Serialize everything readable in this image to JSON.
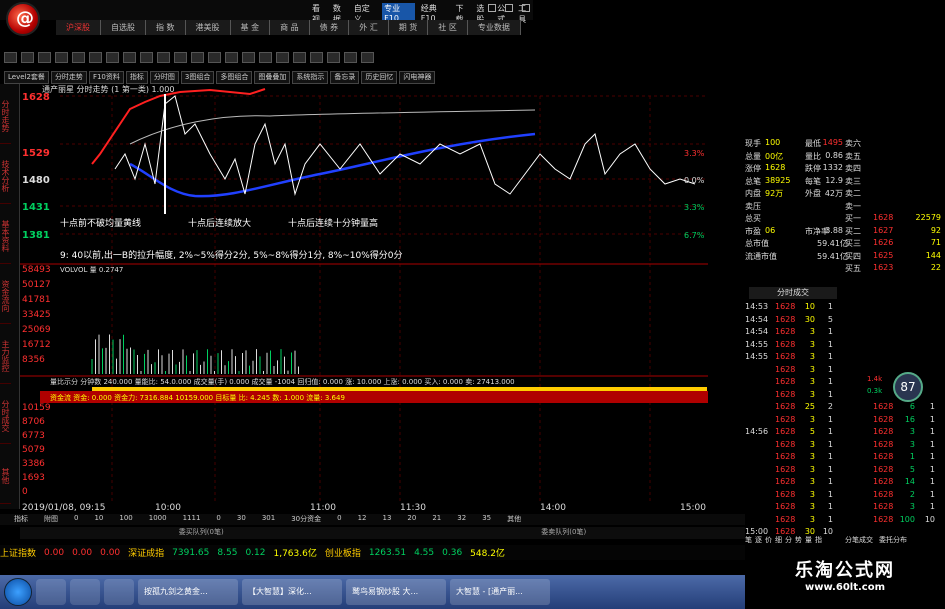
{
  "app": {
    "top_menu": [
      "看视",
      "数据",
      "自定义",
      "专业F10",
      "经典F10",
      "下载",
      "选股",
      "公式",
      "工具"
    ],
    "top_menu_active": "专业F10"
  },
  "nav_tabs": [
    "沪深股",
    "自选股",
    "指 数",
    "港美股",
    "基 金",
    "商 品",
    "债 券",
    "外 汇",
    "期 货",
    "社 区",
    "专业数据"
  ],
  "toolbar2": [
    "Level2套餐",
    "分时走势",
    "F10资料",
    "指标",
    "分时图",
    "3图组合",
    "多图组合",
    "图叠叠加",
    "系统指示",
    "备忘录",
    "历史回忆",
    "闪电神器"
  ],
  "left_strip": [
    "分时走势",
    "技术分析",
    "基本资料",
    "资金流向",
    "主力监控",
    "分时成交",
    "其他"
  ],
  "chart": {
    "header": "通产丽星 分时走势  (1 第一类) 1.000",
    "price_labels": [
      "1628",
      "1529",
      "1480",
      "1431",
      "1381"
    ],
    "pct_labels": [
      "3.3%",
      "0.0%",
      "3.3%",
      "6.7%"
    ],
    "annotation_line1": "十点前不破均量黄线",
    "annotation_line2": "十点后连续放大",
    "annotation_line3": "十点后连续十分钟量高",
    "score_text": "9: 40以前,出一B的拉升幅度, 2%~5%得分2分, 5%~8%得分1分, 8%~10%得分0分",
    "vol_labels": [
      "58493",
      "50127",
      "41781",
      "33425",
      "25069",
      "16712",
      "8356"
    ],
    "vol_header": "VOLVOL 量  0.2747",
    "sub_header": "量比示分  分钟数 240.000  量能比: 54.0.000  成交量(手)  0.000  成交量 -1004  回归值: 0.000  涨: 10.000  上涨: 0.000  买入: 0.000  卖: 27413.000",
    "sub_labels": [
      "10159",
      "8706",
      "6773",
      "5079",
      "3386",
      "1693",
      "0"
    ],
    "money_header": "资金流  资金: 0.000  资金力: 7316.884  10159.000  目标量  比: 4.245  数: 1.000  流量: 3.649",
    "time_labels": [
      "2019/01/08, 09:15",
      "10:00",
      "11:00",
      "11:30",
      "14:00",
      "15:00"
    ]
  },
  "axis_row": {
    "items": [
      "指标",
      "附图",
      "0",
      "10",
      "100",
      "1000",
      "1111",
      "0",
      "30",
      "301",
      "30分资金",
      "0",
      "12",
      "13",
      "20",
      "21",
      "32",
      "35",
      "其他"
    ]
  },
  "queue": {
    "left": "委买队列(0笔)",
    "right": "委卖队列(0笔)"
  },
  "quote": {
    "rows": [
      {
        "l": "现手",
        "lv": "100",
        "m": "最低",
        "mv": "1495",
        "r": "卖六"
      },
      {
        "l": "总量",
        "lv": "00亿",
        "m": "量比",
        "mv": "0.86",
        "r": "卖五"
      },
      {
        "l": "涨停",
        "lv": "1628",
        "m": "跌停",
        "mv": "1332",
        "r": "卖四"
      },
      {
        "l": "总笔",
        "lv": "38925",
        "m": "每笔",
        "mv": "12.9",
        "r": "卖三"
      },
      {
        "l": "内盘",
        "lv": "92万",
        "m": "外盘",
        "mv": "42万",
        "r": "卖二"
      },
      {
        "l": "卖压",
        "lv": "",
        "m": "",
        "mv": "",
        "r": "卖一"
      },
      {
        "l": "总买",
        "lv": "",
        "m": "",
        "mv": "",
        "r": "买一"
      },
      {
        "l": "市盈",
        "lv": "06",
        "m": "市净率",
        "mv": "3.88",
        "r": "买二"
      },
      {
        "l": "总市值",
        "lv": "",
        "m": "",
        "mv": "59.41亿",
        "r": "买三"
      },
      {
        "l": "流通市值",
        "lv": "",
        "m": "",
        "mv": "59.41亿",
        "r": "买四"
      },
      {
        "l": "",
        "lv": "",
        "m": "",
        "mv": "",
        "r": "买五"
      }
    ],
    "book": [
      {
        "p": "",
        "v": ""
      },
      {
        "p": "",
        "v": ""
      },
      {
        "p": "",
        "v": ""
      },
      {
        "p": "",
        "v": ""
      },
      {
        "p": "",
        "v": ""
      },
      {
        "p": "",
        "v": ""
      },
      {
        "p": "1628",
        "v": "22579"
      },
      {
        "p": "1627",
        "v": "92"
      },
      {
        "p": "1626",
        "v": "71"
      },
      {
        "p": "1625",
        "v": "144"
      },
      {
        "p": "1623",
        "v": "22"
      }
    ],
    "ticks_header": "分时成交",
    "ticks": [
      {
        "t": "14:53",
        "p": "1628",
        "v": "10",
        "n": "1"
      },
      {
        "t": "14:54",
        "p": "1628",
        "v": "30",
        "n": "5"
      },
      {
        "t": "14:54",
        "p": "1628",
        "v": "3",
        "n": "1"
      },
      {
        "t": "14:55",
        "p": "1628",
        "v": "3",
        "n": "1"
      },
      {
        "t": "14:55",
        "p": "1628",
        "v": "3",
        "n": "1"
      },
      {
        "t": "",
        "p": "1628",
        "v": "3",
        "n": "1"
      },
      {
        "t": "",
        "p": "1628",
        "v": "3",
        "n": "1"
      },
      {
        "t": "",
        "p": "1628",
        "v": "3",
        "n": "1"
      },
      {
        "t": "",
        "p": "1628",
        "v": "25",
        "n": "2"
      },
      {
        "t": "",
        "p": "1628",
        "v": "3",
        "n": "1"
      },
      {
        "t": "14:56",
        "p": "1628",
        "v": "5",
        "n": "1"
      },
      {
        "t": "",
        "p": "1628",
        "v": "3",
        "n": "1"
      },
      {
        "t": "",
        "p": "1628",
        "v": "3",
        "n": "1"
      },
      {
        "t": "",
        "p": "1628",
        "v": "3",
        "n": "1"
      },
      {
        "t": "",
        "p": "1628",
        "v": "3",
        "n": "1"
      },
      {
        "t": "",
        "p": "1628",
        "v": "3",
        "n": "1"
      },
      {
        "t": "",
        "p": "1628",
        "v": "3",
        "n": "1"
      },
      {
        "t": "",
        "p": "1628",
        "v": "3",
        "n": "1"
      },
      {
        "t": "15:00",
        "p": "1628",
        "v": "30",
        "n": "10"
      }
    ],
    "ticks2": [
      {
        "t": "1628",
        "v": "6",
        "n": "1"
      },
      {
        "t": "1628",
        "v": "16",
        "n": "1"
      },
      {
        "t": "1628",
        "v": "3",
        "n": "1"
      },
      {
        "t": "1628",
        "v": "3",
        "n": "1"
      },
      {
        "t": "1628",
        "v": "1",
        "n": "1"
      },
      {
        "t": "1628",
        "v": "5",
        "n": "1"
      },
      {
        "t": "1628",
        "v": "14",
        "n": "1"
      },
      {
        "t": "1628",
        "v": "2",
        "n": "1"
      },
      {
        "t": "1628",
        "v": "3",
        "n": "1"
      },
      {
        "t": "1628",
        "v": "100",
        "n": "10"
      }
    ],
    "bottom_tabs": [
      "笔",
      "逐",
      "价",
      "细",
      "分",
      "势",
      "量",
      "指"
    ],
    "bottom_tabs2": [
      "分笔成交",
      "委托分布"
    ],
    "gauge": "87",
    "gauge_up": "1.4k",
    "gauge_dn": "0.3k"
  },
  "index_bar": [
    {
      "name": "上证指数",
      "a": "0.00",
      "b": "0.00",
      "c": "0.00"
    },
    {
      "name": "深证成指",
      "a": "7391.65",
      "b": "8.55",
      "c": "0.12",
      "d": "1,763.6亿"
    },
    {
      "name": "创业板指",
      "a": "1263.51",
      "b": "4.55",
      "c": "0.36",
      "d": "548.2亿"
    }
  ],
  "taskbar": {
    "tasks": [
      "按孤九剑之黄金...",
      "【大智慧】深化...",
      "鹫鸟易钢炒股 大...",
      "大智慧 - [通产丽..."
    ]
  },
  "watermark": {
    "title": "乐淘公式网",
    "url": "www.60lt.com"
  },
  "colors": {
    "up": "#ff3030",
    "down": "#00d060",
    "accent_yellow": "#ffff00",
    "avg_line": "#2040ff",
    "price_line": "#ffffff"
  }
}
